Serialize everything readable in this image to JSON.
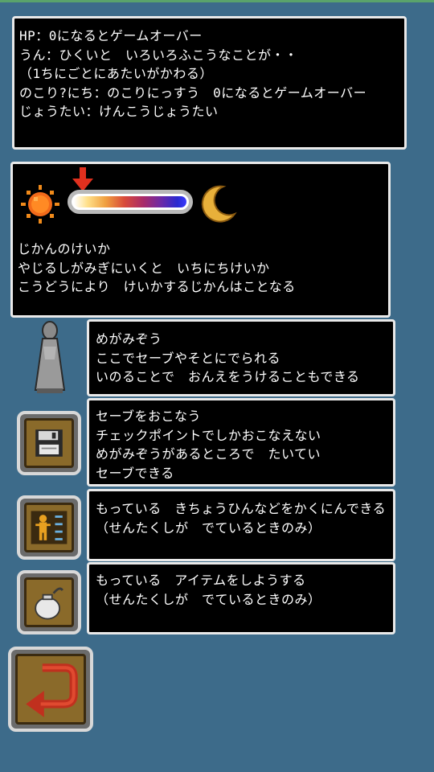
{
  "hp_panel": {
    "lines": [
      "HP：0になるとゲームオーバー",
      "うん：ひくいと　いろいろふこうなことが・・",
      "（1ちにごとにあたいがかわる）",
      "のこり?にち：のこりにっすう　0になるとゲームオーバー",
      "じょうたい：けんこうじょうたい"
    ]
  },
  "time_panel": {
    "progress": 0.05,
    "lines": [
      "じかんのけいか",
      "やじるしがみぎにいくと　いちにちけいか",
      "こうどうにより　けいかするじかんはことなる"
    ]
  },
  "statue_panel": {
    "lines": [
      "めがみぞう",
      "ここでセーブやそとにでられる",
      "いのることで　おんえをうけることもできる"
    ]
  },
  "save_panel": {
    "lines": [
      "セーブをおこなう",
      "チェックポイントでしかおこなえない",
      "めがみぞうがあるところで　たいてい",
      "セーブできる"
    ]
  },
  "status_panel": {
    "lines": [
      "もっている　きちょうひんなどをかくにんできる",
      "（せんたくしが　でているときのみ）"
    ]
  },
  "item_panel": {
    "lines": [
      "もっている　アイテムをしようする",
      "（せんたくしが　でているときのみ）"
    ]
  },
  "colors": {
    "background": "#3d6b8a",
    "panel": "#000000",
    "panel_border": "#e9e9e9",
    "button_frame": "#6b6b6b",
    "button_inner": "#8a6a2a"
  },
  "icons": {
    "sun": "sun-icon",
    "moon": "crescent-moon-icon",
    "arrow": "down-arrow-icon",
    "statue": "goddess-statue-icon",
    "save": "floppy-disk-icon",
    "status": "character-status-icon",
    "item": "item-bag-icon",
    "back": "return-arrow-icon"
  }
}
